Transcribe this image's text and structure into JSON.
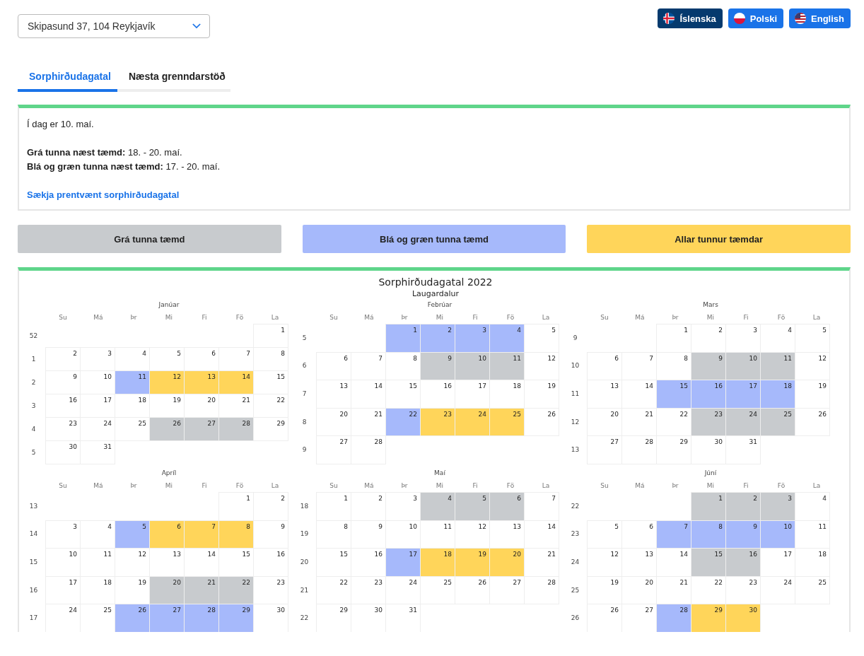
{
  "address_select": {
    "value": "Skipasund 37, 104 Reykjavík"
  },
  "languages": [
    {
      "label": "Íslenska",
      "selected": true
    },
    {
      "label": "Polski",
      "selected": false
    },
    {
      "label": "English",
      "selected": false
    }
  ],
  "tabs": [
    {
      "label": "Sorphirðudagatal",
      "selected": true
    },
    {
      "label": "Næsta grenndarstöð",
      "selected": false
    }
  ],
  "info": {
    "today": "Í dag er 10. maí.",
    "lines": [
      "**Grá tunna næst tæmd:** 18. - 20. maí.",
      "**Blá og græn tunna næst tæmd:** 17. - 20. maí."
    ],
    "link": "Sækja prentvænt sorphirðudagatal"
  },
  "legend": [
    {
      "label": "Grá tunna tæmd",
      "kind": "grey",
      "color": "#c8cbce"
    },
    {
      "label": "Blá og græn tunna tæmd",
      "kind": "blue",
      "color": "#a6b9fb"
    },
    {
      "label": "Allar tunnur tæmdar",
      "kind": "all",
      "color": "#ffd55a"
    }
  ],
  "calendar": {
    "title": "Sorphirðudagatal 2022",
    "subtitle": "Laugardalur",
    "months": [
      {
        "name": "Janúar",
        "weekdays": [
          "Su",
          "Má",
          "Þr",
          "Mi",
          "Fi",
          "Fö",
          "La"
        ],
        "weeks": [
          {
            "number": "52",
            "days": [
              {
                "day": "1",
                "kind": "none"
              }
            ]
          },
          {
            "number": "1",
            "days": [
              {
                "day": "2",
                "kind": "none"
              },
              {
                "day": "3",
                "kind": "none"
              },
              {
                "day": "4",
                "kind": "none"
              },
              {
                "day": "5",
                "kind": "none"
              },
              {
                "day": "6",
                "kind": "none"
              },
              {
                "day": "7",
                "kind": "none"
              },
              {
                "day": "8",
                "kind": "none"
              }
            ]
          },
          {
            "number": "2",
            "days": [
              {
                "day": "9",
                "kind": "none"
              },
              {
                "day": "10",
                "kind": "none"
              },
              {
                "day": "11",
                "kind": "blue"
              },
              {
                "day": "12",
                "kind": "all"
              },
              {
                "day": "13",
                "kind": "all"
              },
              {
                "day": "14",
                "kind": "all"
              },
              {
                "day": "15",
                "kind": "none"
              }
            ]
          },
          {
            "number": "3",
            "days": [
              {
                "day": "16",
                "kind": "none"
              },
              {
                "day": "17",
                "kind": "none"
              },
              {
                "day": "18",
                "kind": "none"
              },
              {
                "day": "19",
                "kind": "none"
              },
              {
                "day": "20",
                "kind": "none"
              },
              {
                "day": "21",
                "kind": "none"
              },
              {
                "day": "22",
                "kind": "none"
              }
            ]
          },
          {
            "number": "4",
            "days": [
              {
                "day": "23",
                "kind": "none"
              },
              {
                "day": "24",
                "kind": "none"
              },
              {
                "day": "25",
                "kind": "none"
              },
              {
                "day": "26",
                "kind": "grey"
              },
              {
                "day": "27",
                "kind": "grey"
              },
              {
                "day": "28",
                "kind": "grey"
              },
              {
                "day": "29",
                "kind": "none"
              }
            ]
          },
          {
            "number": "5",
            "days": [
              {
                "day": "30",
                "kind": "none"
              },
              {
                "day": "31",
                "kind": "none"
              }
            ]
          }
        ]
      },
      {
        "name": "Febrúar",
        "weekdays": [
          "Su",
          "Má",
          "Þr",
          "Mi",
          "Fi",
          "Fö",
          "La"
        ],
        "weeks": [
          {
            "number": "5",
            "days": [
              {
                "day": "1",
                "kind": "blue"
              },
              {
                "day": "2",
                "kind": "blue"
              },
              {
                "day": "3",
                "kind": "blue"
              },
              {
                "day": "4",
                "kind": "blue"
              },
              {
                "day": "5",
                "kind": "none"
              }
            ]
          },
          {
            "number": "6",
            "days": [
              {
                "day": "6",
                "kind": "none"
              },
              {
                "day": "7",
                "kind": "none"
              },
              {
                "day": "8",
                "kind": "none"
              },
              {
                "day": "9",
                "kind": "grey"
              },
              {
                "day": "10",
                "kind": "grey"
              },
              {
                "day": "11",
                "kind": "grey"
              },
              {
                "day": "12",
                "kind": "none"
              }
            ]
          },
          {
            "number": "7",
            "days": [
              {
                "day": "13",
                "kind": "none"
              },
              {
                "day": "14",
                "kind": "none"
              },
              {
                "day": "15",
                "kind": "none"
              },
              {
                "day": "16",
                "kind": "none"
              },
              {
                "day": "17",
                "kind": "none"
              },
              {
                "day": "18",
                "kind": "none"
              },
              {
                "day": "19",
                "kind": "none"
              }
            ]
          },
          {
            "number": "8",
            "days": [
              {
                "day": "20",
                "kind": "none"
              },
              {
                "day": "21",
                "kind": "none"
              },
              {
                "day": "22",
                "kind": "blue"
              },
              {
                "day": "23",
                "kind": "all"
              },
              {
                "day": "24",
                "kind": "all"
              },
              {
                "day": "25",
                "kind": "all"
              },
              {
                "day": "26",
                "kind": "none"
              }
            ]
          },
          {
            "number": "9",
            "days": [
              {
                "day": "27",
                "kind": "none"
              },
              {
                "day": "28",
                "kind": "none"
              }
            ]
          }
        ]
      },
      {
        "name": "Mars",
        "weekdays": [
          "Su",
          "Má",
          "Þr",
          "Mi",
          "Fi",
          "Fö",
          "La"
        ],
        "weeks": [
          {
            "number": "9",
            "days": [
              {
                "day": "1",
                "kind": "none"
              },
              {
                "day": "2",
                "kind": "none"
              },
              {
                "day": "3",
                "kind": "none"
              },
              {
                "day": "4",
                "kind": "none"
              },
              {
                "day": "5",
                "kind": "none"
              }
            ]
          },
          {
            "number": "10",
            "days": [
              {
                "day": "6",
                "kind": "none"
              },
              {
                "day": "7",
                "kind": "none"
              },
              {
                "day": "8",
                "kind": "none"
              },
              {
                "day": "9",
                "kind": "grey"
              },
              {
                "day": "10",
                "kind": "grey"
              },
              {
                "day": "11",
                "kind": "grey"
              },
              {
                "day": "12",
                "kind": "none"
              }
            ]
          },
          {
            "number": "11",
            "days": [
              {
                "day": "13",
                "kind": "none"
              },
              {
                "day": "14",
                "kind": "none"
              },
              {
                "day": "15",
                "kind": "blue"
              },
              {
                "day": "16",
                "kind": "blue"
              },
              {
                "day": "17",
                "kind": "blue"
              },
              {
                "day": "18",
                "kind": "blue"
              },
              {
                "day": "19",
                "kind": "none"
              }
            ]
          },
          {
            "number": "12",
            "days": [
              {
                "day": "20",
                "kind": "none"
              },
              {
                "day": "21",
                "kind": "none"
              },
              {
                "day": "22",
                "kind": "none"
              },
              {
                "day": "23",
                "kind": "grey"
              },
              {
                "day": "24",
                "kind": "grey"
              },
              {
                "day": "25",
                "kind": "grey"
              },
              {
                "day": "26",
                "kind": "none"
              }
            ]
          },
          {
            "number": "13",
            "days": [
              {
                "day": "27",
                "kind": "none"
              },
              {
                "day": "28",
                "kind": "none"
              },
              {
                "day": "29",
                "kind": "none"
              },
              {
                "day": "30",
                "kind": "none"
              },
              {
                "day": "31",
                "kind": "none"
              }
            ]
          }
        ]
      },
      {
        "name": "Apríl",
        "weekdays": [
          "Su",
          "Má",
          "Þr",
          "Mi",
          "Fi",
          "Fö",
          "La"
        ],
        "weeks": [
          {
            "number": "13",
            "days": [
              {
                "day": "1",
                "kind": "none"
              },
              {
                "day": "2",
                "kind": "none"
              }
            ]
          },
          {
            "number": "14",
            "days": [
              {
                "day": "3",
                "kind": "none"
              },
              {
                "day": "4",
                "kind": "none"
              },
              {
                "day": "5",
                "kind": "blue"
              },
              {
                "day": "6",
                "kind": "all"
              },
              {
                "day": "7",
                "kind": "all"
              },
              {
                "day": "8",
                "kind": "all"
              },
              {
                "day": "9",
                "kind": "none"
              }
            ]
          },
          {
            "number": "15",
            "days": [
              {
                "day": "10",
                "kind": "none"
              },
              {
                "day": "11",
                "kind": "none"
              },
              {
                "day": "12",
                "kind": "none"
              },
              {
                "day": "13",
                "kind": "none"
              },
              {
                "day": "14",
                "kind": "none"
              },
              {
                "day": "15",
                "kind": "none"
              },
              {
                "day": "16",
                "kind": "none"
              }
            ]
          },
          {
            "number": "16",
            "days": [
              {
                "day": "17",
                "kind": "none"
              },
              {
                "day": "18",
                "kind": "none"
              },
              {
                "day": "19",
                "kind": "none"
              },
              {
                "day": "20",
                "kind": "grey"
              },
              {
                "day": "21",
                "kind": "grey"
              },
              {
                "day": "22",
                "kind": "grey"
              },
              {
                "day": "23",
                "kind": "none"
              }
            ]
          },
          {
            "number": "17",
            "days": [
              {
                "day": "24",
                "kind": "none"
              },
              {
                "day": "25",
                "kind": "none"
              },
              {
                "day": "26",
                "kind": "blue"
              },
              {
                "day": "27",
                "kind": "blue"
              },
              {
                "day": "28",
                "kind": "blue"
              },
              {
                "day": "29",
                "kind": "blue"
              },
              {
                "day": "30",
                "kind": "none"
              }
            ]
          }
        ]
      },
      {
        "name": "Maí",
        "weekdays": [
          "Su",
          "Má",
          "Þr",
          "Mi",
          "Fi",
          "Fö",
          "La"
        ],
        "weeks": [
          {
            "number": "18",
            "days": [
              {
                "day": "1",
                "kind": "none"
              },
              {
                "day": "2",
                "kind": "none"
              },
              {
                "day": "3",
                "kind": "none"
              },
              {
                "day": "4",
                "kind": "grey"
              },
              {
                "day": "5",
                "kind": "grey"
              },
              {
                "day": "6",
                "kind": "grey"
              },
              {
                "day": "7",
                "kind": "none"
              }
            ]
          },
          {
            "number": "19",
            "days": [
              {
                "day": "8",
                "kind": "none"
              },
              {
                "day": "9",
                "kind": "none"
              },
              {
                "day": "10",
                "kind": "none"
              },
              {
                "day": "11",
                "kind": "none"
              },
              {
                "day": "12",
                "kind": "none"
              },
              {
                "day": "13",
                "kind": "none"
              },
              {
                "day": "14",
                "kind": "none"
              }
            ]
          },
          {
            "number": "20",
            "days": [
              {
                "day": "15",
                "kind": "none"
              },
              {
                "day": "16",
                "kind": "none"
              },
              {
                "day": "17",
                "kind": "blue"
              },
              {
                "day": "18",
                "kind": "all"
              },
              {
                "day": "19",
                "kind": "all"
              },
              {
                "day": "20",
                "kind": "all"
              },
              {
                "day": "21",
                "kind": "none"
              }
            ]
          },
          {
            "number": "21",
            "days": [
              {
                "day": "22",
                "kind": "none"
              },
              {
                "day": "23",
                "kind": "none"
              },
              {
                "day": "24",
                "kind": "none"
              },
              {
                "day": "25",
                "kind": "none"
              },
              {
                "day": "26",
                "kind": "none"
              },
              {
                "day": "27",
                "kind": "none"
              },
              {
                "day": "28",
                "kind": "none"
              }
            ]
          },
          {
            "number": "22",
            "days": [
              {
                "day": "29",
                "kind": "none"
              },
              {
                "day": "30",
                "kind": "none"
              },
              {
                "day": "31",
                "kind": "none"
              }
            ]
          }
        ]
      },
      {
        "name": "Júní",
        "weekdays": [
          "Su",
          "Má",
          "Þr",
          "Mi",
          "Fi",
          "Fö",
          "La"
        ],
        "weeks": [
          {
            "number": "22",
            "days": [
              {
                "day": "1",
                "kind": "grey"
              },
              {
                "day": "2",
                "kind": "grey"
              },
              {
                "day": "3",
                "kind": "grey"
              },
              {
                "day": "4",
                "kind": "none"
              }
            ]
          },
          {
            "number": "23",
            "days": [
              {
                "day": "5",
                "kind": "none"
              },
              {
                "day": "6",
                "kind": "none"
              },
              {
                "day": "7",
                "kind": "blue"
              },
              {
                "day": "8",
                "kind": "blue"
              },
              {
                "day": "9",
                "kind": "blue"
              },
              {
                "day": "10",
                "kind": "blue"
              },
              {
                "day": "11",
                "kind": "none"
              }
            ]
          },
          {
            "number": "24",
            "days": [
              {
                "day": "12",
                "kind": "none"
              },
              {
                "day": "13",
                "kind": "none"
              },
              {
                "day": "14",
                "kind": "none"
              },
              {
                "day": "15",
                "kind": "grey"
              },
              {
                "day": "16",
                "kind": "grey"
              },
              {
                "day": "17",
                "kind": "none"
              },
              {
                "day": "18",
                "kind": "none"
              }
            ]
          },
          {
            "number": "25",
            "days": [
              {
                "day": "19",
                "kind": "none"
              },
              {
                "day": "20",
                "kind": "none"
              },
              {
                "day": "21",
                "kind": "none"
              },
              {
                "day": "22",
                "kind": "none"
              },
              {
                "day": "23",
                "kind": "none"
              },
              {
                "day": "24",
                "kind": "none"
              },
              {
                "day": "25",
                "kind": "none"
              }
            ]
          },
          {
            "number": "26",
            "days": [
              {
                "day": "26",
                "kind": "none"
              },
              {
                "day": "27",
                "kind": "none"
              },
              {
                "day": "28",
                "kind": "blue"
              },
              {
                "day": "29",
                "kind": "all"
              },
              {
                "day": "30",
                "kind": "all"
              }
            ]
          }
        ]
      }
    ]
  }
}
